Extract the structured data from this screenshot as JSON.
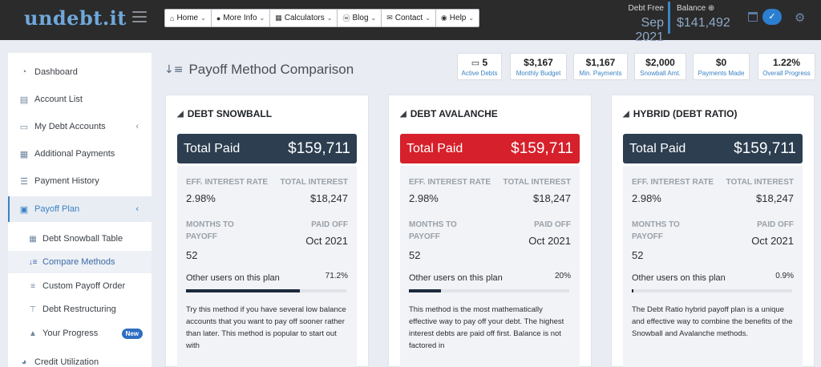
{
  "brand": {
    "logo": "undebt.it"
  },
  "nav": {
    "items": [
      {
        "icon": "home-icon",
        "glyph": "⌂",
        "label": "Home"
      },
      {
        "icon": "info-icon",
        "glyph": "●",
        "label": "More Info"
      },
      {
        "icon": "calculator-icon",
        "glyph": "▦",
        "label": "Calculators"
      },
      {
        "icon": "wordpress-icon",
        "glyph": "ⓦ",
        "label": "Blog"
      },
      {
        "icon": "envelope-icon",
        "glyph": "✉",
        "label": "Contact"
      },
      {
        "icon": "help-icon",
        "glyph": "◉",
        "label": "Help"
      }
    ]
  },
  "header": {
    "debt_free_label": "Debt Free",
    "debt_free_value": "Sep 2021",
    "balance_label": "Balance",
    "balance_value": "$141,492"
  },
  "sidebar": {
    "items": [
      {
        "label": "Dashboard",
        "icon": "tachometer-icon",
        "glyph": "◔"
      },
      {
        "label": "Account List",
        "icon": "list-alt-icon",
        "glyph": "▤"
      },
      {
        "label": "My Debt Accounts",
        "icon": "credit-card-icon",
        "glyph": "▭",
        "chevron": "‹"
      },
      {
        "label": "Additional Payments",
        "icon": "th-large-icon",
        "glyph": "▦"
      },
      {
        "label": "Payment History",
        "icon": "list-ol-icon",
        "glyph": "☰"
      },
      {
        "label": "Payoff Plan",
        "icon": "calendar-check-icon",
        "glyph": "▣",
        "chevron": "‹"
      },
      {
        "label": "Credit Utilization",
        "icon": "pie-chart-icon",
        "glyph": "◕"
      }
    ],
    "subitems": [
      {
        "label": "Debt Snowball Table",
        "icon": "table-icon",
        "glyph": "▦"
      },
      {
        "label": "Compare Methods",
        "icon": "sort-amount-icon",
        "glyph": "↓≡"
      },
      {
        "label": "Custom Payoff Order",
        "icon": "bars-icon",
        "glyph": "≡"
      },
      {
        "label": "Debt Restructuring",
        "icon": "signs-icon",
        "glyph": "⊤"
      },
      {
        "label": "Your Progress",
        "icon": "mountain-icon",
        "glyph": "▲",
        "badge": "New"
      }
    ]
  },
  "page": {
    "title": "Payoff Method Comparison"
  },
  "stats": [
    {
      "value": "5",
      "label": "Active Debts",
      "icon": "credit-card-icon",
      "glyph": "▭"
    },
    {
      "value": "$3,167",
      "label": "Monthly Budget"
    },
    {
      "value": "$1,167",
      "label": "Min. Payments"
    },
    {
      "value": "$2,000",
      "label": "Snowball Amt."
    },
    {
      "value": "$0",
      "label": "Payments Made"
    },
    {
      "value": "1.22%",
      "label": "Overall Progress"
    }
  ],
  "cards": [
    {
      "title": "DEBT SNOWBALL",
      "total_label": "Total Paid",
      "total_value": "$159,711",
      "total_color": "#2c3e50",
      "eff_rate_label": "EFF. INTEREST RATE",
      "eff_rate": "2.98%",
      "total_interest_label": "TOTAL INTEREST",
      "total_interest": "$18,247",
      "months_label": "MONTHS TO PAYOFF",
      "months": "52",
      "paid_off_label": "PAID OFF",
      "paid_off": "Oct 2021",
      "users_label": "Other users on this plan",
      "users_pct": "71.2%",
      "users_fraction": 0.712,
      "description": "Try this method if you have several low balance accounts that you want to pay off sooner rather than later. This method is popular to start out with"
    },
    {
      "title": "DEBT AVALANCHE",
      "total_label": "Total Paid",
      "total_value": "$159,711",
      "total_color": "#d6202b",
      "eff_rate_label": "EFF. INTEREST RATE",
      "eff_rate": "2.98%",
      "total_interest_label": "TOTAL INTEREST",
      "total_interest": "$18,247",
      "months_label": "MONTHS TO PAYOFF",
      "months": "52",
      "paid_off_label": "PAID OFF",
      "paid_off": "Oct 2021",
      "users_label": "Other users on this plan",
      "users_pct": "20%",
      "users_fraction": 0.2,
      "description": "This method is the most mathematically effective way to pay off your debt. The highest interest debts are paid off first. Balance is not factored in"
    },
    {
      "title": "HYBRID (DEBT RATIO)",
      "total_label": "Total Paid",
      "total_value": "$159,711",
      "total_color": "#2c3e50",
      "eff_rate_label": "EFF. INTEREST RATE",
      "eff_rate": "2.98%",
      "total_interest_label": "TOTAL INTEREST",
      "total_interest": "$18,247",
      "months_label": "MONTHS TO PAYOFF",
      "months": "52",
      "paid_off_label": "PAID OFF",
      "paid_off": "Oct 2021",
      "users_label": "Other users on this plan",
      "users_pct": "0.9%",
      "users_fraction": 0.009,
      "description": "The Debt Ratio hybrid payoff plan is a unique and effective way to combine the benefits of the Snowball and Avalanche methods."
    }
  ],
  "colors": {
    "accent": "#3b82c4",
    "dark_total": "#2c3e50",
    "red_total": "#d6202b"
  }
}
